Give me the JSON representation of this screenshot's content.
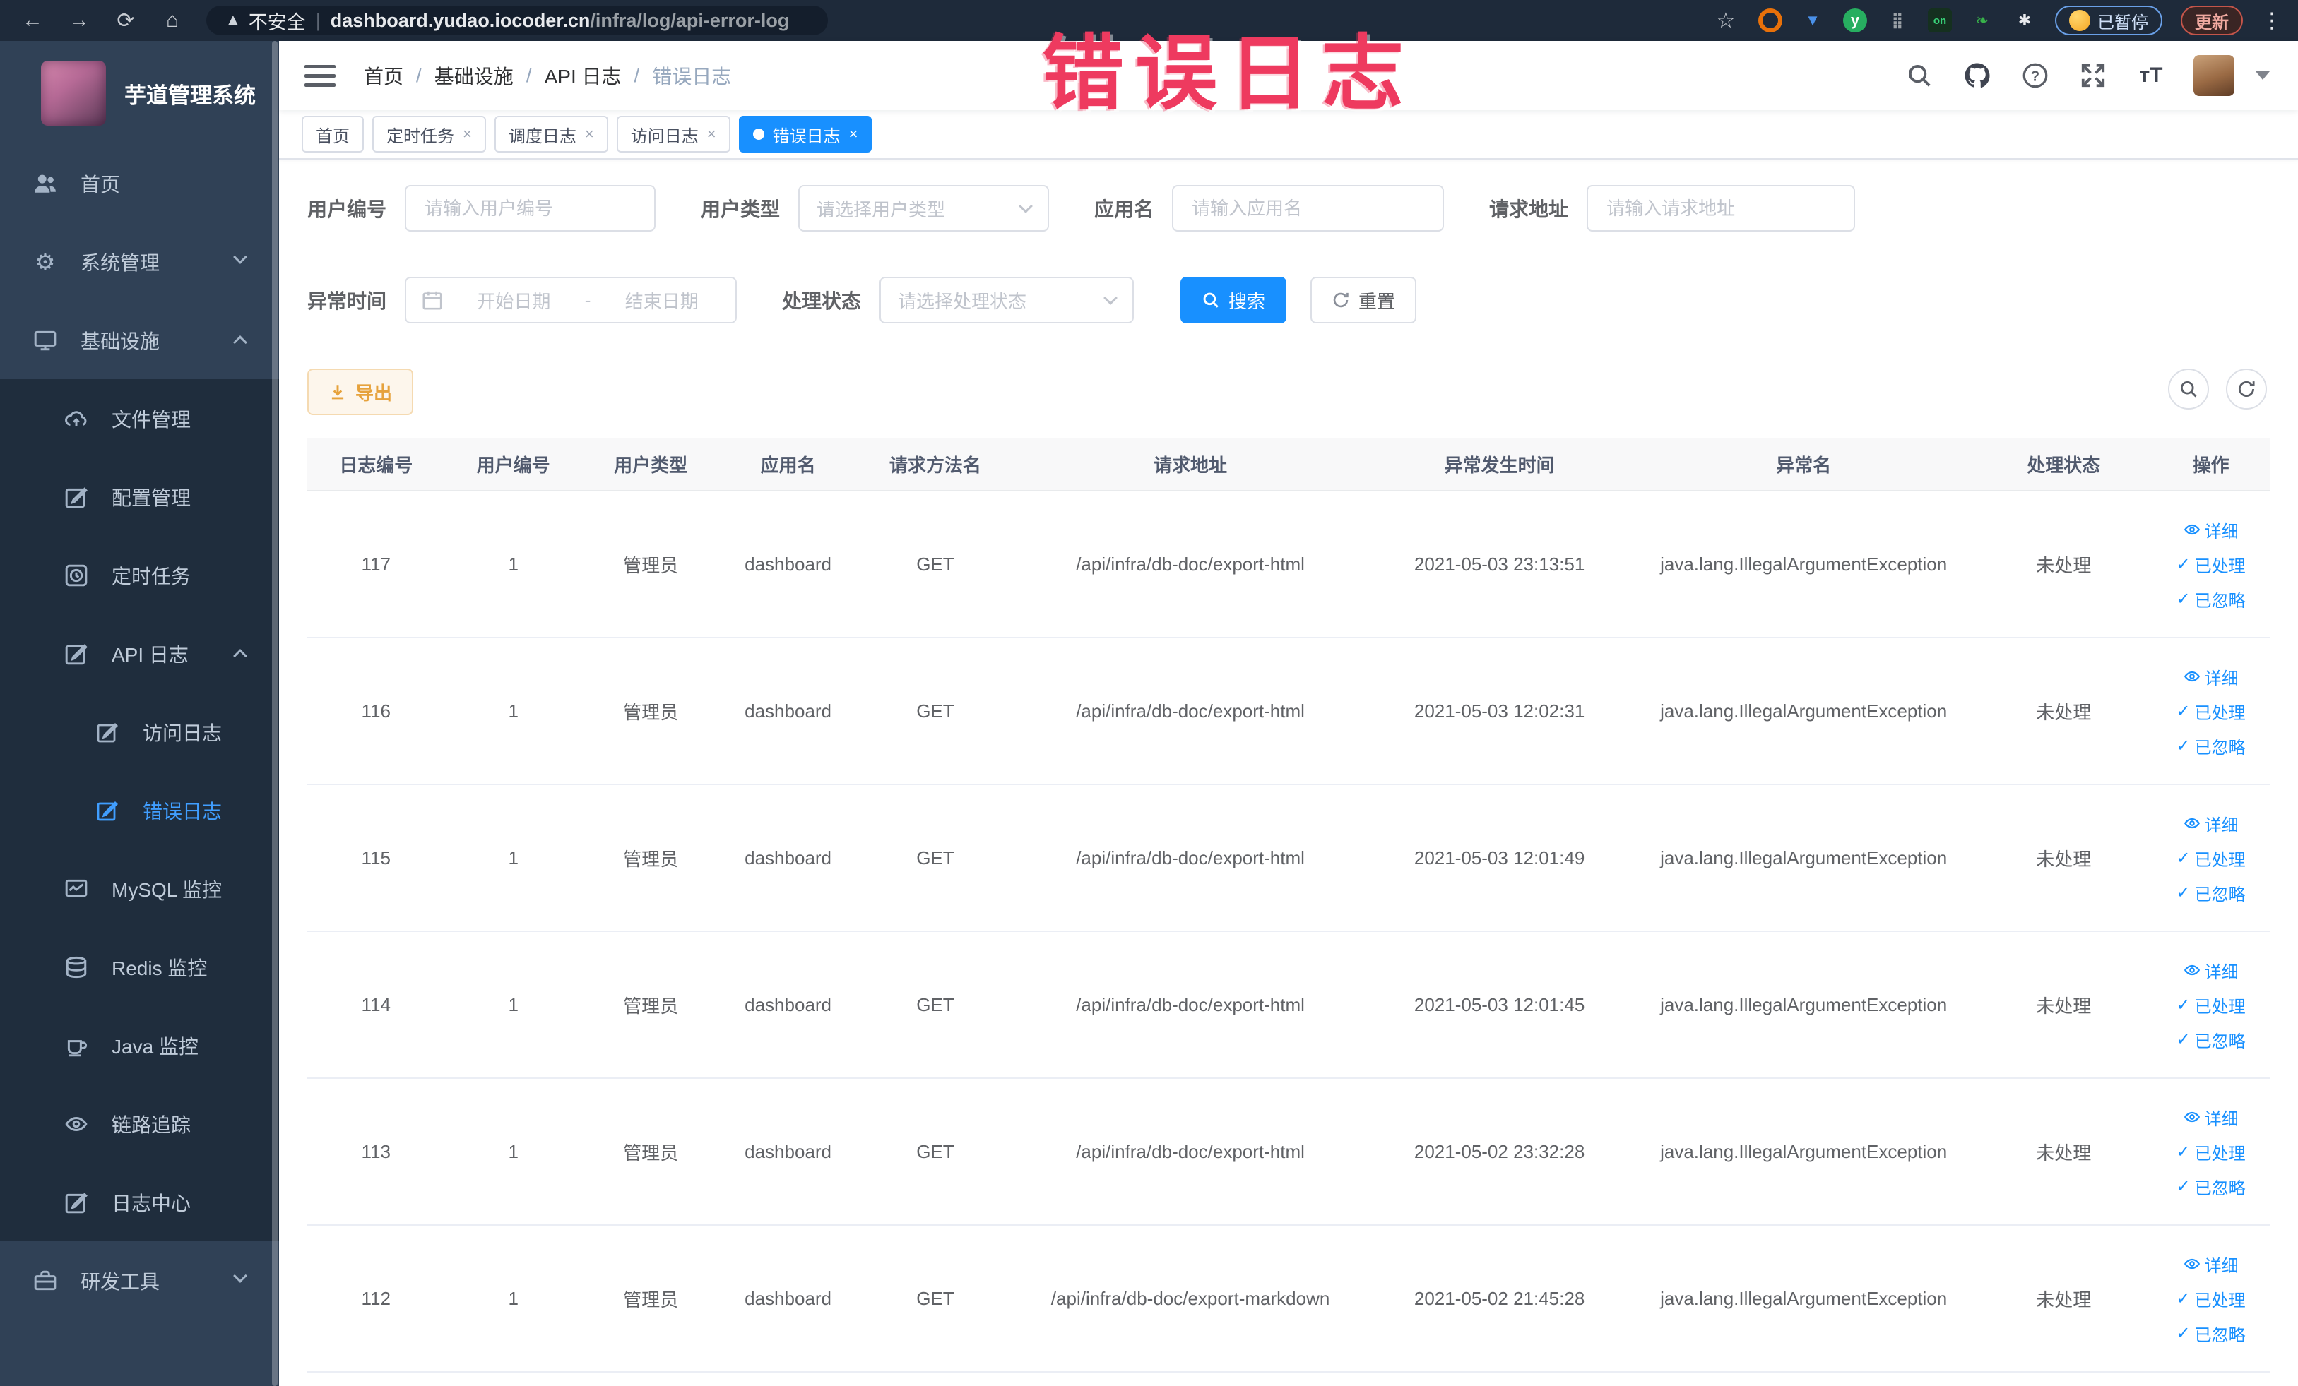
{
  "browser": {
    "security_label": "不安全",
    "url_host": "dashboard.yudao.iocoder.cn",
    "url_path": "/infra/log/api-error-log",
    "profile_pill": "已暂停",
    "update_button": "更新"
  },
  "annotation": {
    "text": "错误日志",
    "color": "#ee3a5f"
  },
  "sidebar": {
    "logo_title": "芋道管理系统",
    "home": "首页",
    "system": "系统管理",
    "infra": "基础设施",
    "file": "文件管理",
    "config": "配置管理",
    "job": "定时任务",
    "api_log": "API 日志",
    "access_log": "访问日志",
    "error_log": "错误日志",
    "mysql": "MySQL 监控",
    "redis": "Redis 监控",
    "java": "Java 监控",
    "trace": "链路追踪",
    "log_center": "日志中心",
    "dev_tools": "研发工具"
  },
  "header": {
    "breadcrumb": [
      "首页",
      "基础设施",
      "API 日志",
      "错误日志"
    ]
  },
  "tags": [
    {
      "label": "首页"
    },
    {
      "label": "定时任务"
    },
    {
      "label": "调度日志"
    },
    {
      "label": "访问日志"
    },
    {
      "label": "错误日志"
    }
  ],
  "filters": {
    "user_id": {
      "label": "用户编号",
      "placeholder": "请输入用户编号"
    },
    "user_type": {
      "label": "用户类型",
      "placeholder": "请选择用户类型"
    },
    "app_name": {
      "label": "应用名",
      "placeholder": "请输入应用名"
    },
    "request_url": {
      "label": "请求地址",
      "placeholder": "请输入请求地址"
    },
    "exception_time": {
      "label": "异常时间",
      "start_placeholder": "开始日期",
      "separator": "-",
      "end_placeholder": "结束日期"
    },
    "process_status": {
      "label": "处理状态",
      "placeholder": "请选择处理状态"
    },
    "search_label": "搜索",
    "reset_label": "重置"
  },
  "toolbar": {
    "export_label": "导出"
  },
  "table": {
    "columns": [
      "日志编号",
      "用户编号",
      "用户类型",
      "应用名",
      "请求方法名",
      "请求地址",
      "异常发生时间",
      "异常名",
      "处理状态",
      "操作"
    ],
    "actions": {
      "detail": "详细",
      "processed": "已处理",
      "ignored": "已忽略"
    },
    "rows": [
      {
        "id": "117",
        "user_id": "1",
        "user_type": "管理员",
        "app": "dashboard",
        "method": "GET",
        "url": "/api/infra/db-doc/export-html",
        "time": "2021-05-03 23:13:51",
        "exception": "java.lang.IllegalArgumentException",
        "status": "未处理"
      },
      {
        "id": "116",
        "user_id": "1",
        "user_type": "管理员",
        "app": "dashboard",
        "method": "GET",
        "url": "/api/infra/db-doc/export-html",
        "time": "2021-05-03 12:02:31",
        "exception": "java.lang.IllegalArgumentException",
        "status": "未处理"
      },
      {
        "id": "115",
        "user_id": "1",
        "user_type": "管理员",
        "app": "dashboard",
        "method": "GET",
        "url": "/api/infra/db-doc/export-html",
        "time": "2021-05-03 12:01:49",
        "exception": "java.lang.IllegalArgumentException",
        "status": "未处理"
      },
      {
        "id": "114",
        "user_id": "1",
        "user_type": "管理员",
        "app": "dashboard",
        "method": "GET",
        "url": "/api/infra/db-doc/export-html",
        "time": "2021-05-03 12:01:45",
        "exception": "java.lang.IllegalArgumentException",
        "status": "未处理"
      },
      {
        "id": "113",
        "user_id": "1",
        "user_type": "管理员",
        "app": "dashboard",
        "method": "GET",
        "url": "/api/infra/db-doc/export-html",
        "time": "2021-05-02 23:32:28",
        "exception": "java.lang.IllegalArgumentException",
        "status": "未处理"
      },
      {
        "id": "112",
        "user_id": "1",
        "user_type": "管理员",
        "app": "dashboard",
        "method": "GET",
        "url": "/api/infra/db-doc/export-markdown",
        "time": "2021-05-02 21:45:28",
        "exception": "java.lang.IllegalArgumentException",
        "status": "未处理"
      }
    ]
  },
  "colors": {
    "primary": "#1890ff",
    "sidebar_active": "#409eff",
    "annotation": "#ee3a5f",
    "warning": "#e6a23c"
  }
}
